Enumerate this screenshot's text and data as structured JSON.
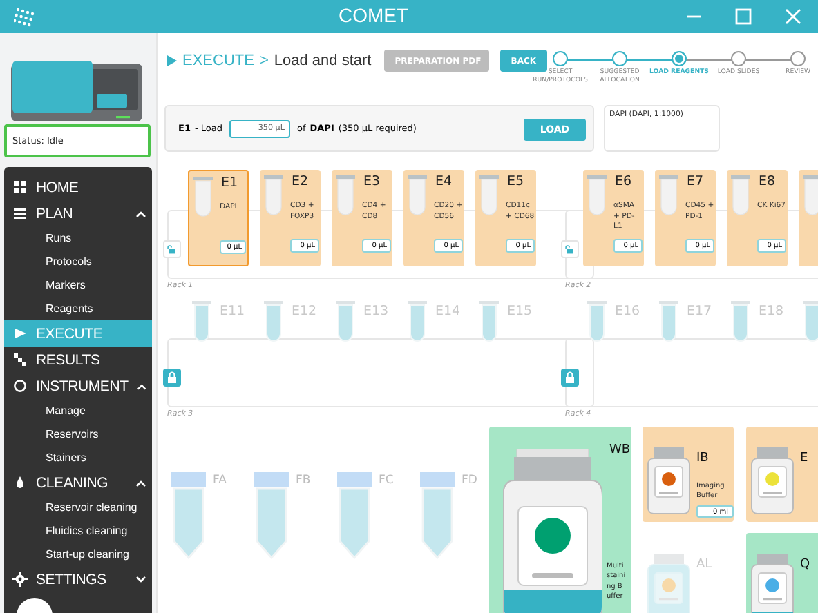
{
  "window": {
    "title": "COMET"
  },
  "instrument": {
    "status": "Status: Idle"
  },
  "sidebar": {
    "items": [
      {
        "label": "HOME",
        "selected": false
      },
      {
        "label": "PLAN",
        "selected": false,
        "expanded": true,
        "children": [
          {
            "label": "Runs"
          },
          {
            "label": "Protocols"
          },
          {
            "label": "Markers"
          },
          {
            "label": "Reagents"
          }
        ]
      },
      {
        "label": "EXECUTE",
        "selected": true
      },
      {
        "label": "RESULTS",
        "selected": false
      },
      {
        "label": "INSTRUMENT",
        "selected": false,
        "expanded": true,
        "children": [
          {
            "label": "Manage"
          },
          {
            "label": "Reservoirs"
          },
          {
            "label": "Stainers"
          }
        ]
      },
      {
        "label": "CLEANING",
        "selected": false,
        "expanded": true,
        "children": [
          {
            "label": "Reservoir cleaning"
          },
          {
            "label": "Fluidics cleaning"
          },
          {
            "label": "Start-up cleaning"
          }
        ]
      },
      {
        "label": "SETTINGS",
        "selected": false,
        "expanded": false
      }
    ]
  },
  "header": {
    "section": "EXECUTE",
    "separator": ">",
    "page": "Load and start",
    "buttons": [
      {
        "label": "PREPARATION PDF",
        "disabled": true
      },
      {
        "label": "BACK",
        "disabled": false
      }
    ]
  },
  "stepper": [
    {
      "label": "SELECT RUN/PROTOCOLS",
      "done": true,
      "selected": false
    },
    {
      "label": "SUGGESTED ALLOCATION",
      "done": true,
      "selected": false
    },
    {
      "label": "LOAD REAGENTS",
      "done": false,
      "selected": true
    },
    {
      "label": "LOAD SLIDES",
      "done": false,
      "selected": false
    },
    {
      "label": "REVIEW",
      "done": false,
      "selected": false
    }
  ],
  "load_panel": {
    "position": "E1",
    "load_text": "- Load",
    "amount": "350 µL",
    "of_text": "of",
    "reagent": "DAPI",
    "required": "(350 µL required)",
    "button": "LOAD",
    "info": "DAPI (DAPI, 1:1000)"
  },
  "racks": [
    {
      "label": "Rack 1",
      "locked": false,
      "slots": [
        {
          "label": "E1",
          "loaded": true,
          "selected": true,
          "description": "DAPI",
          "volume": "0 µL"
        },
        {
          "label": "E2",
          "loaded": true,
          "selected": false,
          "description": "CD3 + FOXP3",
          "volume": "0 µL"
        },
        {
          "label": "E3",
          "loaded": true,
          "selected": false,
          "description": "CD4 + CD8",
          "volume": "0 µL"
        },
        {
          "label": "E4",
          "loaded": true,
          "selected": false,
          "description": "CD20 + CD56",
          "volume": "0 µL"
        },
        {
          "label": "E5",
          "loaded": true,
          "selected": false,
          "description": "CD11c + CD68",
          "volume": "0 µL"
        }
      ]
    },
    {
      "label": "Rack 2",
      "locked": false,
      "slots": [
        {
          "label": "E6",
          "loaded": true,
          "selected": false,
          "description": "αSMA + PD-L1",
          "volume": "0 µL"
        },
        {
          "label": "E7",
          "loaded": true,
          "selected": false,
          "description": "CD45 + PD-1",
          "volume": "0 µL"
        },
        {
          "label": "E8",
          "loaded": true,
          "selected": false,
          "description": "CK Ki67",
          "volume": "0 µL"
        },
        {
          "loaded": true,
          "selected": false
        }
      ]
    },
    {
      "label": "Rack 3",
      "locked": true,
      "slots": [
        {
          "label": "E11",
          "loaded": false
        },
        {
          "label": "E12",
          "loaded": false
        },
        {
          "label": "E13",
          "loaded": false
        },
        {
          "label": "E14",
          "loaded": false
        },
        {
          "label": "E15",
          "loaded": false
        }
      ]
    },
    {
      "label": "Rack 4",
      "locked": true,
      "slots": [
        {
          "label": "E16",
          "loaded": false
        },
        {
          "label": "E17",
          "loaded": false
        },
        {
          "label": "E18",
          "loaded": false
        },
        {
          "loaded": false
        }
      ]
    }
  ],
  "falcon_tubes": [
    {
      "label": "FA"
    },
    {
      "label": "FB"
    },
    {
      "label": "FC"
    },
    {
      "label": "FD"
    }
  ],
  "bottles": [
    {
      "kind": "large",
      "label": "WB",
      "description": "Multistaining Buffer",
      "loaded": true,
      "ready": true,
      "color": "#00a070"
    },
    {
      "kind": "small",
      "label": "IB",
      "description": "Imaging Buffer",
      "volume": "0 ml",
      "loaded": true,
      "ready": false,
      "color": "#d95f0e"
    },
    {
      "kind": "small",
      "label": "E",
      "loaded": true,
      "ready": false,
      "color": "#ece23a"
    },
    {
      "kind": "small",
      "label": "AL",
      "loaded": false,
      "color": "#f7d9a8"
    },
    {
      "kind": "small",
      "label": "Q",
      "loaded": true,
      "ready": true,
      "color": "#4aaee6"
    }
  ]
}
